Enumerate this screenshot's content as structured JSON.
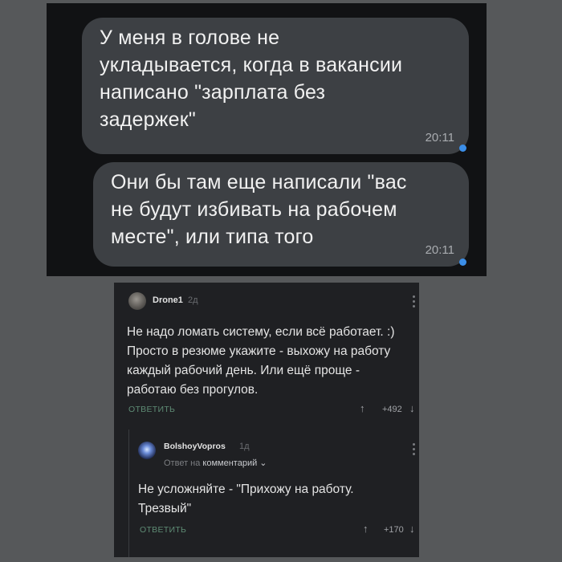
{
  "chat": {
    "messages": [
      {
        "text": "У меня в голове не\nукладывается, когда в вакансии\nнаписано \"зарплата без\nзадержек\"",
        "time": "20:11"
      },
      {
        "text": "Они бы там еще написали \"вас\nне будут избивать на рабочем\nместе\", или типа того",
        "time": "20:11"
      }
    ],
    "accent_color": "#3b8ee8"
  },
  "comments": [
    {
      "author": "Drone1",
      "age": "2д",
      "text": "Не надо ломать систему, если всё работает. :)\nПросто в резюме укажите - выхожу на работу\nкаждый рабочий день. Или ещё проще -\nработаю без прогулов.",
      "reply_label": "ОТВЕТИТЬ",
      "score": "+492"
    },
    {
      "author": "BolshoyVopros",
      "age": "1д",
      "reply_prefix": "Ответ на",
      "reply_target": "комментарий",
      "text": "Не усложняйте - \"Прихожу на работу.\nТрезвый\"",
      "reply_label": "ОТВЕТИТЬ",
      "score": "+170"
    }
  ],
  "icons": {
    "upvote": "↑",
    "downvote": "↓",
    "chevron": "⌄"
  }
}
